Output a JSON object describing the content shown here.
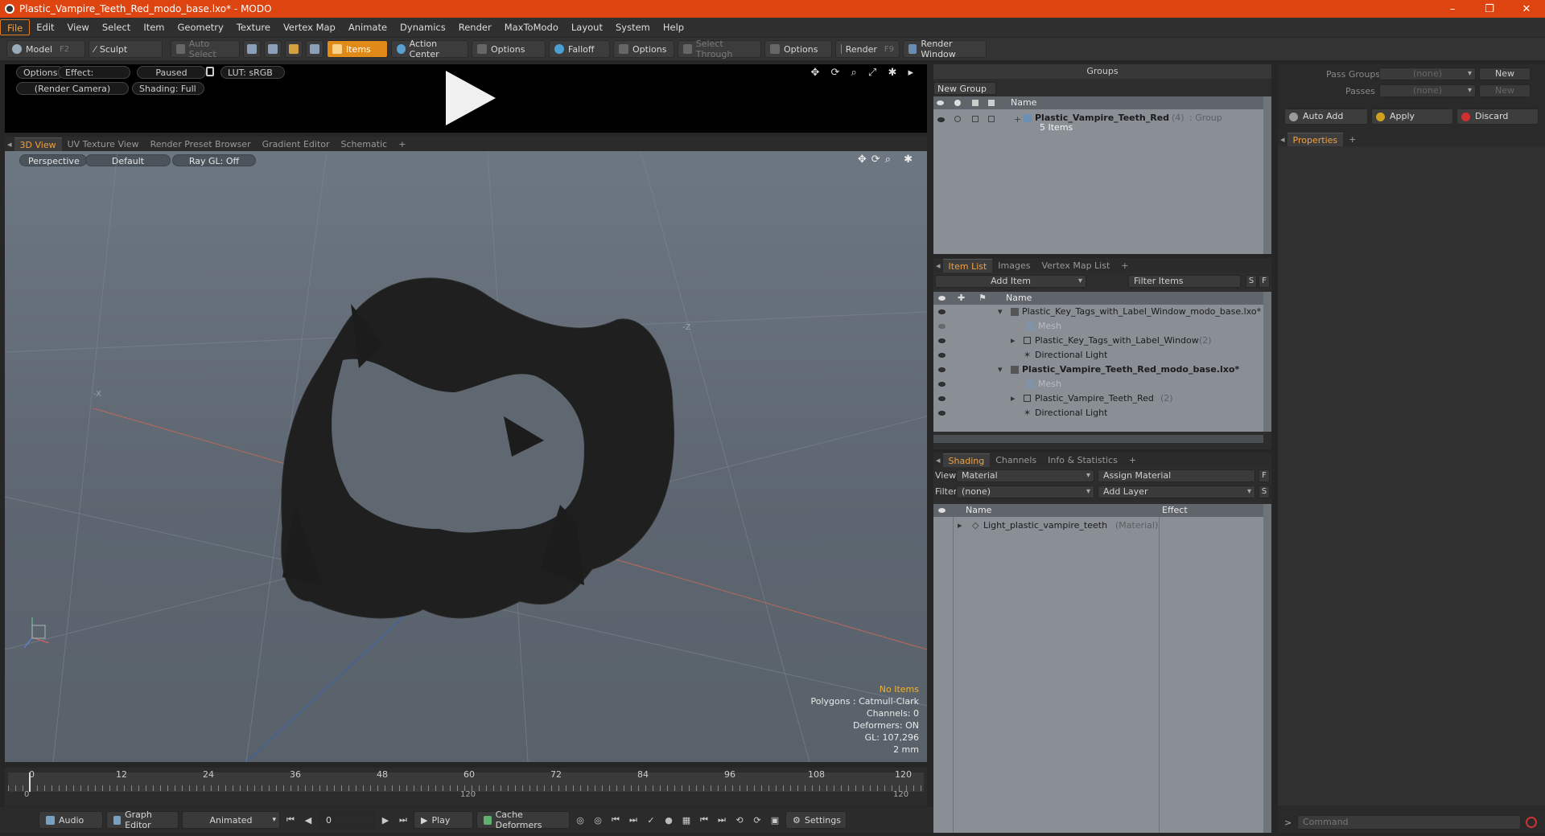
{
  "window": {
    "title": "Plastic_Vampire_Teeth_Red_modo_base.lxo* - MODO",
    "minimize": "–",
    "maximize": "❐",
    "close": "✕"
  },
  "menu": [
    "File",
    "Edit",
    "View",
    "Select",
    "Item",
    "Geometry",
    "Texture",
    "Vertex Map",
    "Animate",
    "Dynamics",
    "Render",
    "MaxToModo",
    "Layout",
    "System",
    "Help"
  ],
  "toolbar": {
    "model": "Model",
    "model_key": "F2",
    "sculpt": "Sculpt",
    "auto_select": "Auto Select",
    "items": "Items",
    "action_center": "Action Center",
    "options1": "Options",
    "falloff": "Falloff",
    "options2": "Options",
    "select_through": "Select Through",
    "options3": "Options",
    "render": "Render",
    "render_key": "F9",
    "render_window": "Render Window"
  },
  "preview": {
    "options": "Options",
    "effect": "Effect: (Shadi...",
    "paused": "Paused",
    "lut": "LUT: sRGB",
    "camera": "(Render Camera)",
    "shading": "Shading: Full"
  },
  "view_tabs": [
    "3D View",
    "UV Texture View",
    "Render Preset Browser",
    "Gradient Editor",
    "Schematic",
    "+"
  ],
  "viewport": {
    "perspective": "Perspective",
    "default": "Default",
    "raygl": "Ray GL: Off",
    "info_warn": "No Items",
    "info_lines": [
      "Polygons : Catmull-Clark",
      "Channels: 0",
      "Deformers: ON",
      "GL: 107,296",
      "2 mm"
    ]
  },
  "timeline": {
    "ticks": [
      "0",
      "12",
      "24",
      "36",
      "48",
      "60",
      "72",
      "84",
      "96",
      "108",
      "120"
    ],
    "range_start": "0",
    "range_mid": "120",
    "range_end": "120"
  },
  "bottombar": {
    "audio": "Audio",
    "graph_editor": "Graph Editor",
    "animated": "Animated",
    "frame": "0",
    "play": "Play",
    "cache_deformers": "Cache Deformers",
    "settings": "Settings"
  },
  "groups": {
    "header": "Groups",
    "new_group": "New Group",
    "col_name": "Name",
    "item_name": "Plastic_Vampire_Teeth_Red",
    "item_count": "(4)",
    "item_type": ": Group",
    "item_sub": "5 Items"
  },
  "itemlist": {
    "tabs": [
      "Item List",
      "Images",
      "Vertex Map List",
      "+"
    ],
    "add_item": "Add Item",
    "filter_items": "Filter Items",
    "s": "S",
    "f": "F",
    "col_name": "Name",
    "rows": [
      {
        "label": "Plastic_Key_Tags_with_Label_Window_modo_base.lxo*",
        "dim": "",
        "bold": false
      },
      {
        "label": "Mesh",
        "dim": "",
        "bold": false,
        "ghost": true
      },
      {
        "label": "Plastic_Key_Tags_with_Label_Window",
        "dim": "(2)",
        "bold": false
      },
      {
        "label": "Directional Light",
        "dim": "",
        "bold": false
      },
      {
        "label": "Plastic_Vampire_Teeth_Red_modo_base.lxo*",
        "dim": "",
        "bold": true
      },
      {
        "label": "Mesh",
        "dim": "",
        "bold": false,
        "ghost": true
      },
      {
        "label": "Plastic_Vampire_Teeth_Red",
        "dim": "(2)",
        "bold": false
      },
      {
        "label": "Directional Light",
        "dim": "",
        "bold": false
      }
    ]
  },
  "shading": {
    "tabs": [
      "Shading",
      "Channels",
      "Info & Statistics",
      "+"
    ],
    "view_label": "View",
    "view_value": "Material",
    "assign_material": "Assign Material",
    "filter_label": "Filter",
    "filter_value": "(none)",
    "add_layer": "Add Layer",
    "f": "F",
    "s": "S",
    "col_name": "Name",
    "col_effect": "Effect",
    "row_name": "Light_plastic_vampire_teeth",
    "row_type": "(Material)"
  },
  "right": {
    "pass_groups_label": "Pass Groups",
    "pass_groups_value": "(none)",
    "passes_label": "Passes",
    "passes_value": "(none)",
    "new1": "New",
    "new2": "New",
    "auto_add": "Auto Add",
    "apply": "Apply",
    "discard": "Discard",
    "properties_tab": "Properties",
    "plus": "+",
    "command_placeholder": "Command"
  }
}
